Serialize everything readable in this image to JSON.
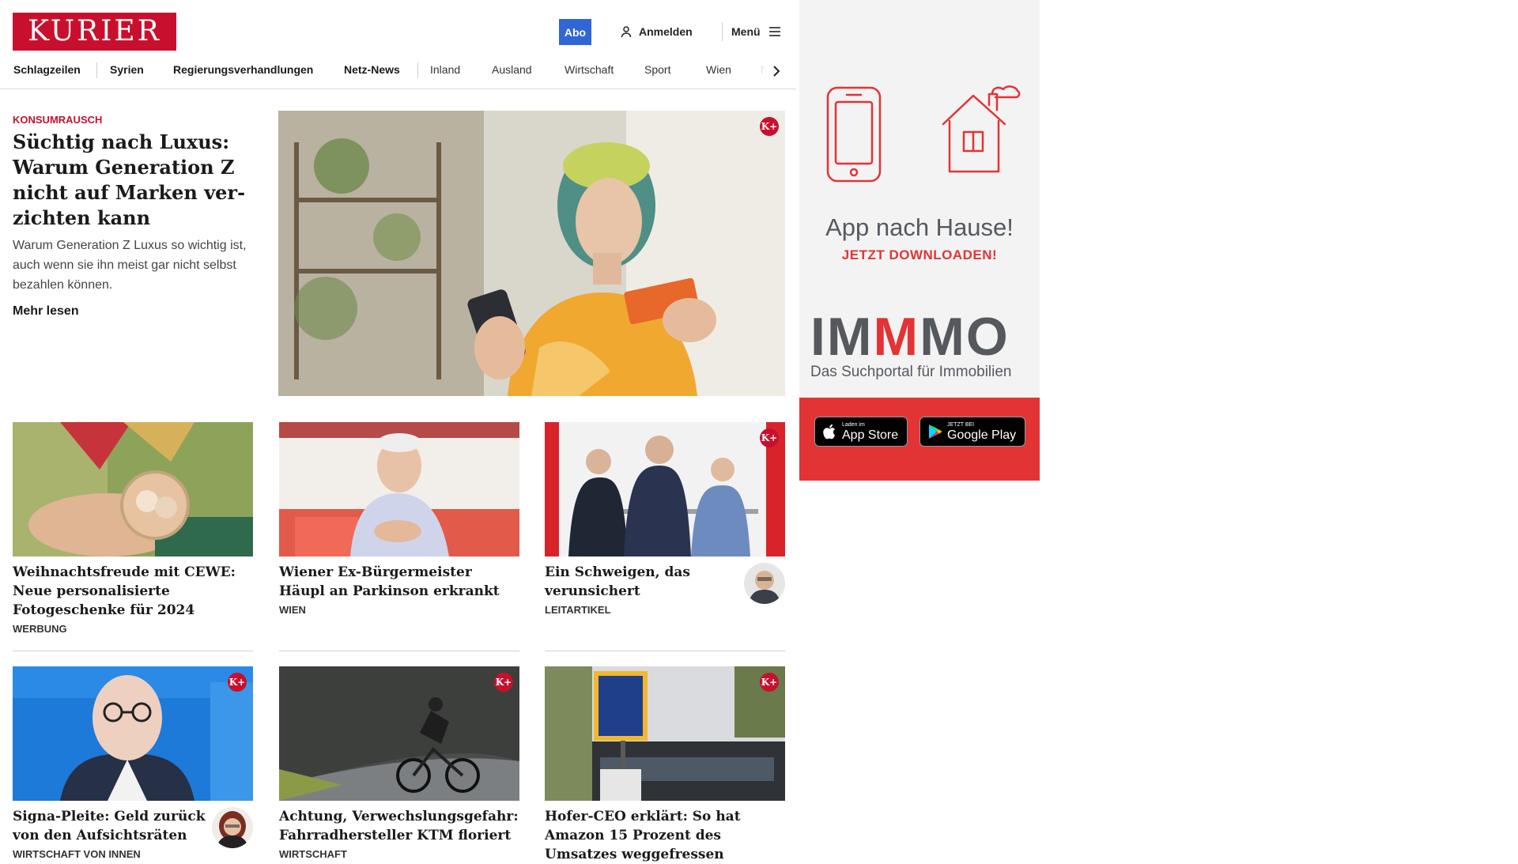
{
  "brand": {
    "logo_text": "KURIER"
  },
  "header": {
    "abo_label": "Abo",
    "login_label": "Anmelden",
    "menu_label": "Menü"
  },
  "nav": {
    "items": [
      "Schlagzeilen",
      "Syrien",
      "Regierungsverhandlungen",
      "Netz-News",
      "Inland",
      "Ausland",
      "Wirtschaft",
      "Sport",
      "Wien",
      "Ne"
    ]
  },
  "hero": {
    "kicker": "Konsumrausch",
    "title": "Süchtig nach Luxus: Warum Generation Z nicht auf Marken ver­zichten kann",
    "teaser": "Warum Generation Z Luxus so wichtig ist, auch wenn sie ihn meist gar nicht selbst bezahlen können.",
    "more_label": "Mehr lesen",
    "premium": true
  },
  "cards": [
    {
      "title": "Weihnachtsfreude mit CEWE: Neue personalisierte Fotogeschenke für 2024",
      "category": "Werbung",
      "premium": false,
      "author_avatar": false
    },
    {
      "title": "Wiener Ex-Bürgermeister Häupl an Parkinson erkrankt",
      "category": "Wien",
      "premium": false,
      "author_avatar": false
    },
    {
      "title": "Ein Schweigen, das verunsichert",
      "category": "Leitartikel",
      "premium": true,
      "author_avatar": true
    },
    {
      "title": "Signa-Pleite: Geld zurück von den Aufsichtsräten",
      "category": "Wirtschaft von innen",
      "premium": true,
      "author_avatar": true
    },
    {
      "title": "Achtung, Verwechslungsgefahr: Fahrradhersteller KTM floriert",
      "category": "Wirtschaft",
      "premium": true,
      "author_avatar": false
    },
    {
      "title": "Hofer-CEO erklärt: So hat Amazon 15 Prozent des Umsatzes weggefressen",
      "category": "",
      "premium": true,
      "author_avatar": false
    }
  ],
  "premium_badge": "K+",
  "ad": {
    "headline": "App nach Hause!",
    "subline": "JETZT DOWNLOADEN!",
    "brand_part1": "IM",
    "brand_part2": "M",
    "brand_part3": "MO",
    "tagline": "Das Suchportal für Immobilien",
    "app_store_small": "Laden im",
    "app_store_big": "App Store",
    "google_play_small": "JETZT BEI",
    "google_play_big": "Google Play",
    "colors": {
      "red": "#e23434",
      "grey": "#55595e"
    }
  },
  "colors": {
    "brand_red": "#c8102e",
    "abo_blue": "#3066d6"
  }
}
